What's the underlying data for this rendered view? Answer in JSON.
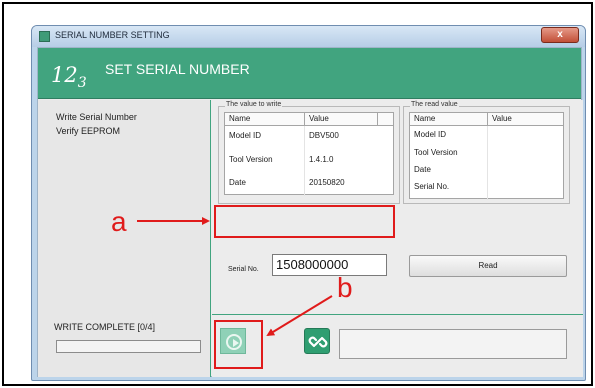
{
  "window": {
    "title": "SERIAL NUMBER SETTING",
    "close_label": "x"
  },
  "header": {
    "logo_main": "12",
    "logo_sub": "3",
    "title": "SET SERIAL NUMBER"
  },
  "left_panel": {
    "steps": [
      "Write Serial Number",
      "Verify EEPROM"
    ],
    "status": "WRITE COMPLETE [0/4]",
    "progress": 0
  },
  "write_group": {
    "label": "The value to write",
    "columns": [
      "Name",
      "Value"
    ],
    "rows": [
      {
        "name": "Model ID",
        "value": "DBV500"
      },
      {
        "name": "Tool Version",
        "value": "1.4.1.0"
      },
      {
        "name": "Date",
        "value": "20150820"
      }
    ],
    "serial_label": "Serial No.",
    "serial_value": "1508000000"
  },
  "read_group": {
    "label": "The read value",
    "columns": [
      "Name",
      "Value"
    ],
    "rows": [
      {
        "name": "Model ID",
        "value": ""
      },
      {
        "name": "Tool Version",
        "value": ""
      },
      {
        "name": "Date",
        "value": ""
      },
      {
        "name": "Serial No.",
        "value": ""
      }
    ],
    "read_button": "Read"
  },
  "bottom": {
    "play_icon": "play-icon",
    "link_icon": "link-icon",
    "message": ""
  },
  "annotations": {
    "a": "a",
    "b": "b",
    "color": "#e01b1b"
  }
}
